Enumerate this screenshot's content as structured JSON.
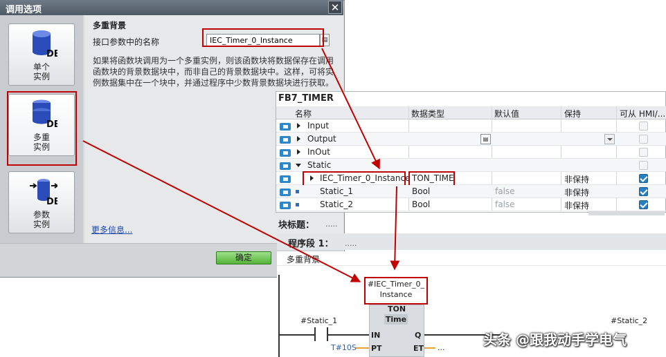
{
  "dialog": {
    "title": "调用选项",
    "options": [
      {
        "line1": "单个",
        "line2": "实例"
      },
      {
        "line1": "多重",
        "line2": "实例"
      },
      {
        "line1": "参数",
        "line2": "实例"
      }
    ],
    "db_badge": "DB",
    "section_title": "多重背景",
    "interface_label": "接口参数中的名称",
    "instance_name": "IEC_Timer_0_Instance",
    "description": "如果将函数块调用为一个多重实例，则该函数块将数据保存在调用函数块的背景数据块中，而非自己的背景数据块中。这样，可将实例数据集中在一个块中，并通过程序中少数背景数据块进行获取。",
    "more_info": "更多信息...",
    "ok_label": "确定"
  },
  "block_table": {
    "title": "FB7_TIMER",
    "headers": [
      "名称",
      "数据类型",
      "默认值",
      "保持",
      "可从 HMI/..."
    ],
    "rows": [
      {
        "name": "Input",
        "type": "",
        "default": "",
        "retain": "",
        "hmi": "dim"
      },
      {
        "name": "Output",
        "type": "",
        "default": "",
        "retain": "",
        "hmi": "dim"
      },
      {
        "name": "InOut",
        "type": "",
        "default": "",
        "retain": "",
        "hmi": "dim"
      },
      {
        "name": "Static",
        "type": "",
        "default": "",
        "retain": "",
        "hmi": "dim"
      },
      {
        "name": "IEC_Timer_0_Instance",
        "type": "TON_TIME",
        "default": "",
        "retain": "非保持",
        "hmi": "on"
      },
      {
        "name": "Static_1",
        "type": "Bool",
        "default": "false",
        "retain": "非保持",
        "hmi": "on"
      },
      {
        "name": "Static_2",
        "type": "Bool",
        "default": "false",
        "retain": "非保持",
        "hmi": "on"
      }
    ]
  },
  "program": {
    "block_title": "块标题：",
    "block_dots": ".....",
    "network_title": "程序段 1：",
    "network_dots": ".....",
    "network_comment": "多重背景",
    "instance_line1": "#IEC_Timer_0_",
    "instance_line2": "Instance",
    "ton": "TON",
    "time": "Time",
    "pin_in": "IN",
    "pin_q": "Q",
    "pin_pt": "PT",
    "pin_et": "ET",
    "pt_value": "T#10S",
    "et_value": "...",
    "contact_tag": "#Static_1",
    "coil_tag": "#Static_2"
  },
  "watermark": "头条 @跟我动手学电气",
  "colors": {
    "highlight": "#c00000",
    "accent": "#2f87c8",
    "ok": "#55b33a"
  }
}
